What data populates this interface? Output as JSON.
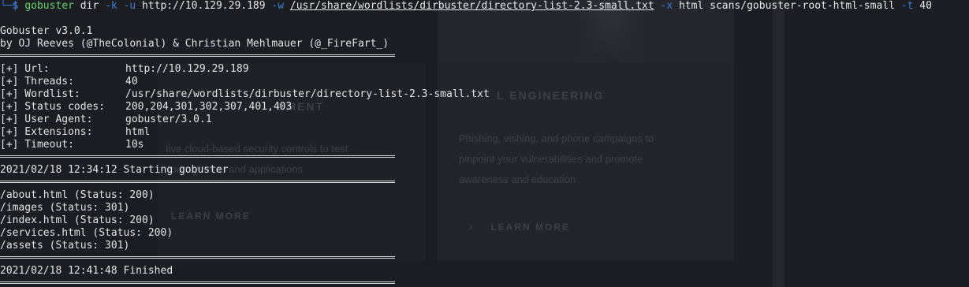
{
  "colors": {
    "background": "#1b1d22",
    "text": "#e4e4e4",
    "prompt": "#3b74d8",
    "command": "#63d66b",
    "flag": "#3e7fd6"
  },
  "prompt": {
    "corner": "└─",
    "sign": "$"
  },
  "command": {
    "name": "gobuster",
    "mode": "dir",
    "flag_k": "-k",
    "flag_u": "-u",
    "url": "http://10.129.29.189",
    "flag_w": "-w",
    "wordlist": "/usr/share/wordlists/dirbuster/directory-list-2.3-small.txt",
    "flag_x": "-x",
    "ext": "html",
    "output_path": "scans/gobuster-root-html-small",
    "flag_t": "-t",
    "threads": "40"
  },
  "banner": {
    "title": "Gobuster v3.0.1",
    "credits": "by OJ Reeves (@TheColonial) & Christian Mehlmauer (@_FireFart_)"
  },
  "config": [
    {
      "label": "[+] Url:",
      "value": "http://10.129.29.189"
    },
    {
      "label": "[+] Threads:",
      "value": "40"
    },
    {
      "label": "[+] Wordlist:",
      "value": "/usr/share/wordlists/dirbuster/directory-list-2.3-small.txt"
    },
    {
      "label": "[+] Status codes:",
      "value": "200,204,301,302,307,401,403"
    },
    {
      "label": "[+] User Agent:",
      "value": "gobuster/3.0.1"
    },
    {
      "label": "[+] Extensions:",
      "value": "html"
    },
    {
      "label": "[+] Timeout:",
      "value": "10s"
    }
  ],
  "start_line": "2021/02/18 12:34:12 Starting gobuster",
  "results": [
    "/about.html (Status: 200)",
    "/images (Status: 301)",
    "/index.html (Status: 200)",
    "/services.html (Status: 200)",
    "/assets (Status: 301)"
  ],
  "finish_line": "2021/02/18 12:41:48 Finished",
  "background_page": {
    "right_heading": "L ENGINEERING",
    "left_heading": "SMENT",
    "right_paragraph": [
      "Phishing, vishing, and phone campaigns to",
      "pinpoint your vulnerabilities and promote",
      "awareness and education"
    ],
    "left_paragraph": [
      "tive cloud-based security controls to test",
      "your systems and applications"
    ],
    "left_link": "LEARN MORE",
    "right_link": "LEARN MORE"
  }
}
